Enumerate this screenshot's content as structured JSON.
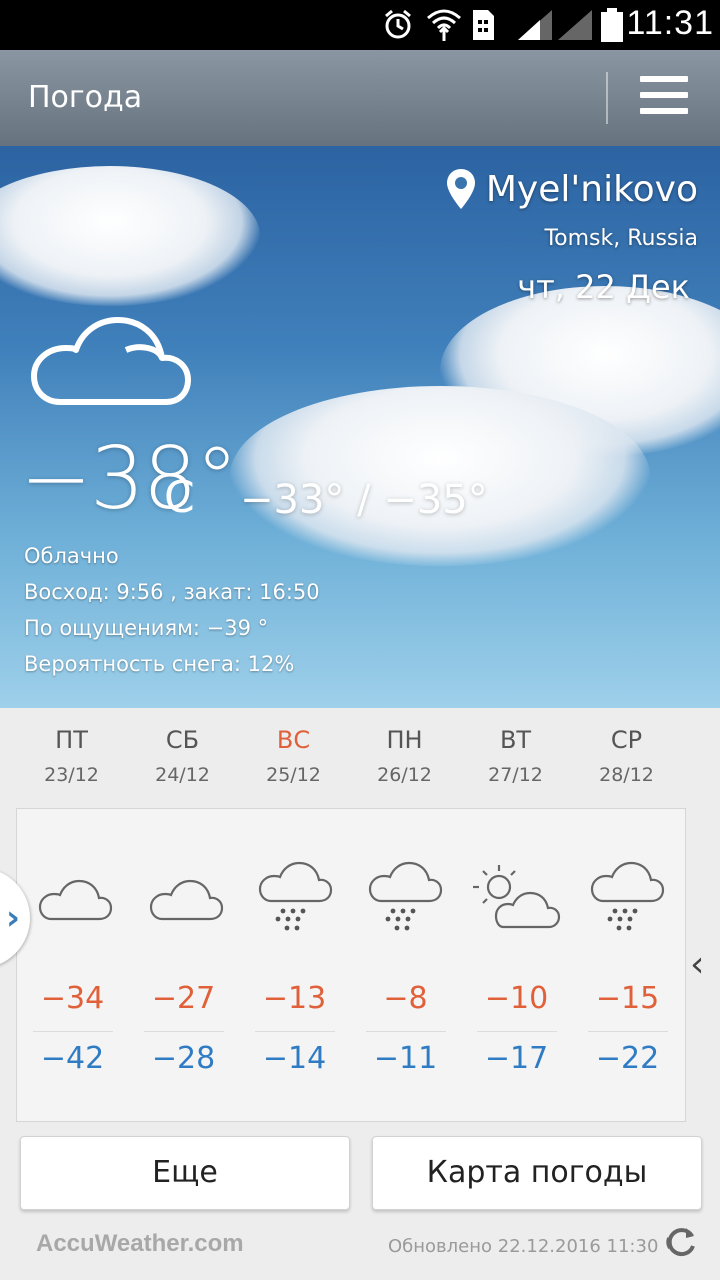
{
  "status_bar": {
    "time": "11:31"
  },
  "app_bar": {
    "title": "Погода"
  },
  "current": {
    "location": "Myel'nikovo",
    "region": "Tomsk, Russia",
    "date": "чт, 22 Дек",
    "temperature": "−38°",
    "unit": "C",
    "range": "−33° / −35°",
    "details": [
      "Облачно",
      "Восход: 9:56 , закат: 16:50",
      "По ощущениям: −39 °",
      "Вероятность снега: 12%"
    ]
  },
  "forecast": [
    {
      "day": "ПТ",
      "date": "23/12",
      "icon": "cloud-icon",
      "high": "−34",
      "low": "−42"
    },
    {
      "day": "СБ",
      "date": "24/12",
      "icon": "cloud-icon",
      "high": "−27",
      "low": "−28"
    },
    {
      "day": "ВС",
      "date": "25/12",
      "icon": "snow-cloud-icon",
      "high": "−13",
      "low": "−14"
    },
    {
      "day": "ПН",
      "date": "26/12",
      "icon": "snow-cloud-icon",
      "high": "−8",
      "low": "−11"
    },
    {
      "day": "ВТ",
      "date": "27/12",
      "icon": "partly-sunny-icon",
      "high": "−10",
      "low": "−17"
    },
    {
      "day": "СР",
      "date": "28/12",
      "icon": "snow-cloud-icon",
      "high": "−15",
      "low": "−22"
    }
  ],
  "buttons": {
    "more": "Еще",
    "map": "Карта погоды"
  },
  "footer": {
    "brand": "AccuWeather.com",
    "updated": "Обновлено 22.12.2016 11:30"
  },
  "colors": {
    "high": "#e0603a",
    "low": "#2f7cc4",
    "sunday": "#e0603a"
  }
}
